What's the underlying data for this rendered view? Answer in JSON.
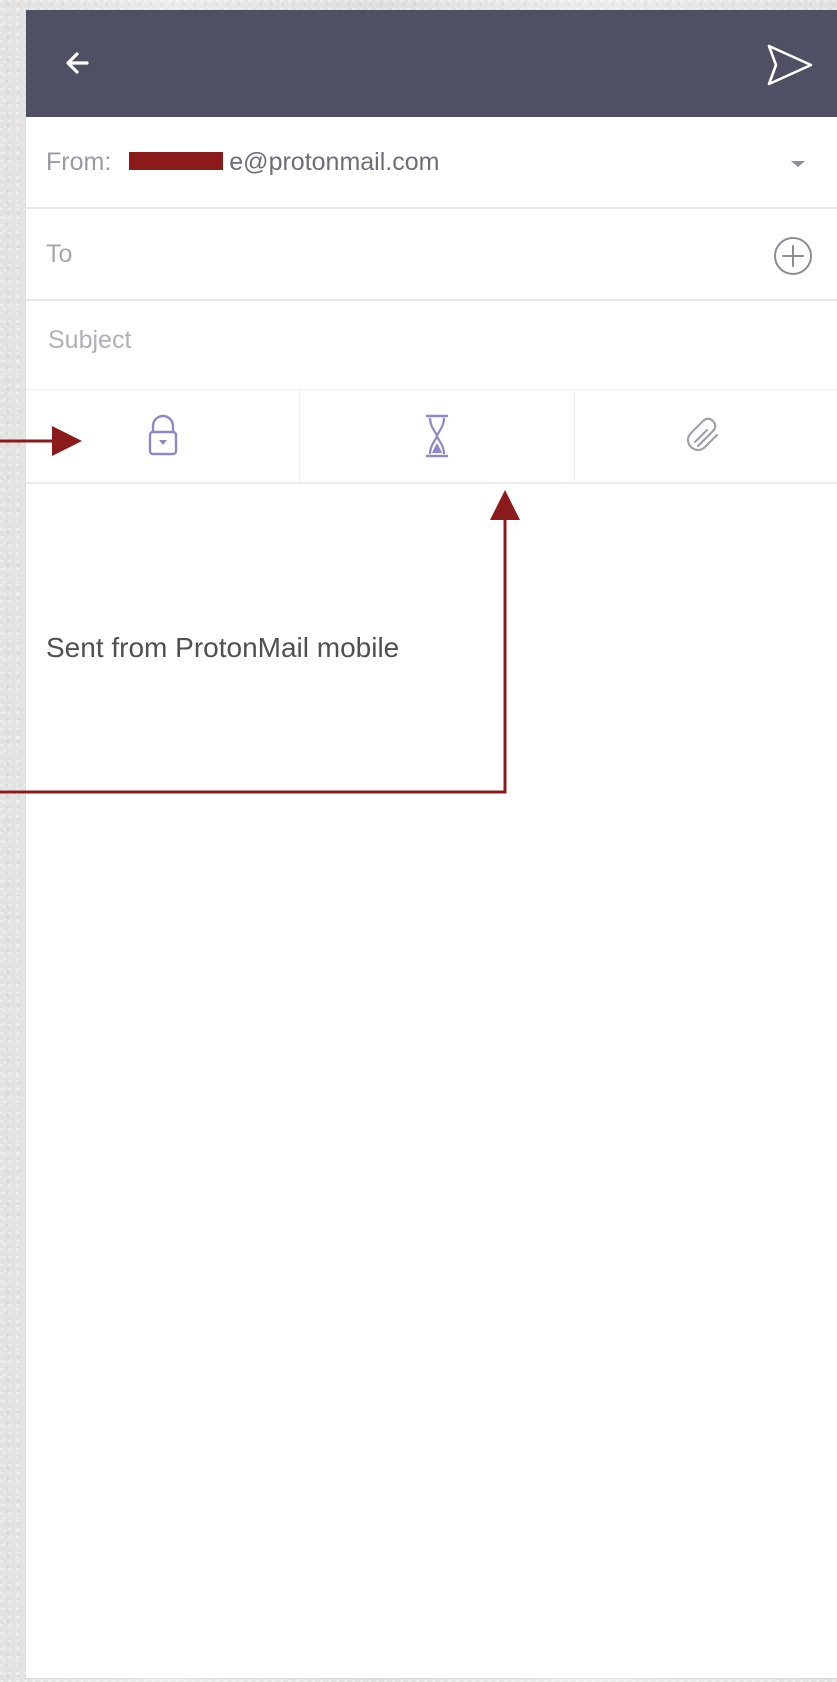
{
  "compose": {
    "from_label": "From:",
    "from_address": "e@protonmail.com",
    "to_label": "To",
    "subject_placeholder": "Subject",
    "signature": "Sent from ProtonMail mobile"
  },
  "icons": {
    "back": "back-arrow-icon",
    "send": "send-icon",
    "dropdown": "chevron-down-icon",
    "add_recipient": "plus-circle-icon",
    "lock": "lock-icon",
    "expiration": "hourglass-icon",
    "attachment": "paperclip-icon"
  },
  "colors": {
    "app_bar": "#4f5063",
    "accent": "#8c88c7",
    "annotation": "#8b1b1b",
    "text_muted": "#a6a6ad"
  }
}
